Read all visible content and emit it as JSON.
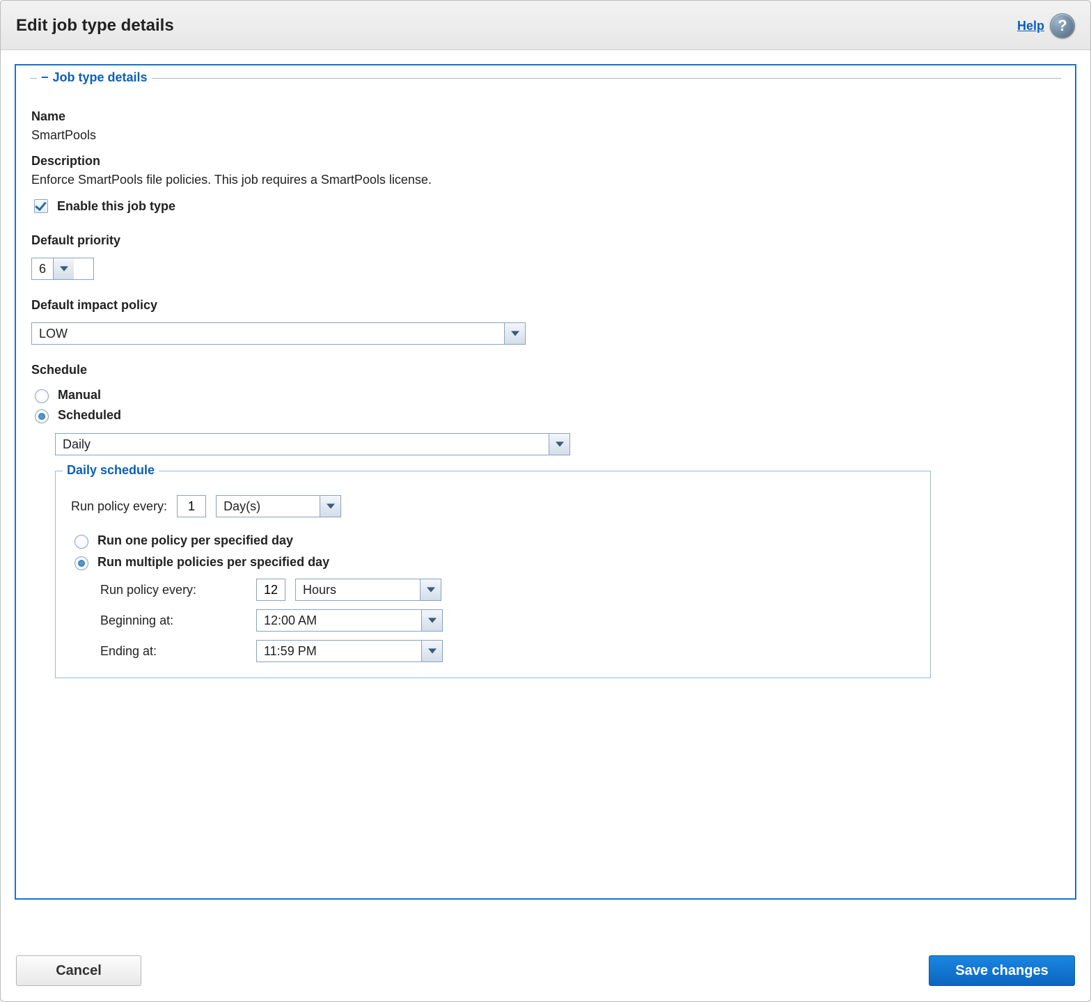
{
  "dialog": {
    "title": "Edit job type details",
    "help_label": "Help"
  },
  "group_legend": "Job type details",
  "name": {
    "label": "Name",
    "value": "SmartPools"
  },
  "description": {
    "label": "Description",
    "value": "Enforce SmartPools file policies. This job requires a SmartPools license."
  },
  "enable": {
    "label": "Enable this job type",
    "checked": true
  },
  "priority": {
    "label": "Default priority",
    "value": "6"
  },
  "impact": {
    "label": "Default impact policy",
    "value": "LOW"
  },
  "schedule": {
    "label": "Schedule",
    "manual_label": "Manual",
    "scheduled_label": "Scheduled",
    "mode": "scheduled",
    "frequency_value": "Daily"
  },
  "daily": {
    "legend": "Daily schedule",
    "run_every_label": "Run policy every:",
    "every_n": "1",
    "every_unit": "Day(s)",
    "run_one_label": "Run one policy per specified day",
    "run_multi_label": "Run multiple policies per specified day",
    "policy_mode": "multiple",
    "multi_every_label": "Run policy every:",
    "multi_every_n": "12",
    "multi_every_unit": "Hours",
    "begin_label": "Beginning at:",
    "begin_value": "12:00 AM",
    "end_label": "Ending at:",
    "end_value": "11:59 PM"
  },
  "buttons": {
    "cancel": "Cancel",
    "save": "Save changes"
  }
}
